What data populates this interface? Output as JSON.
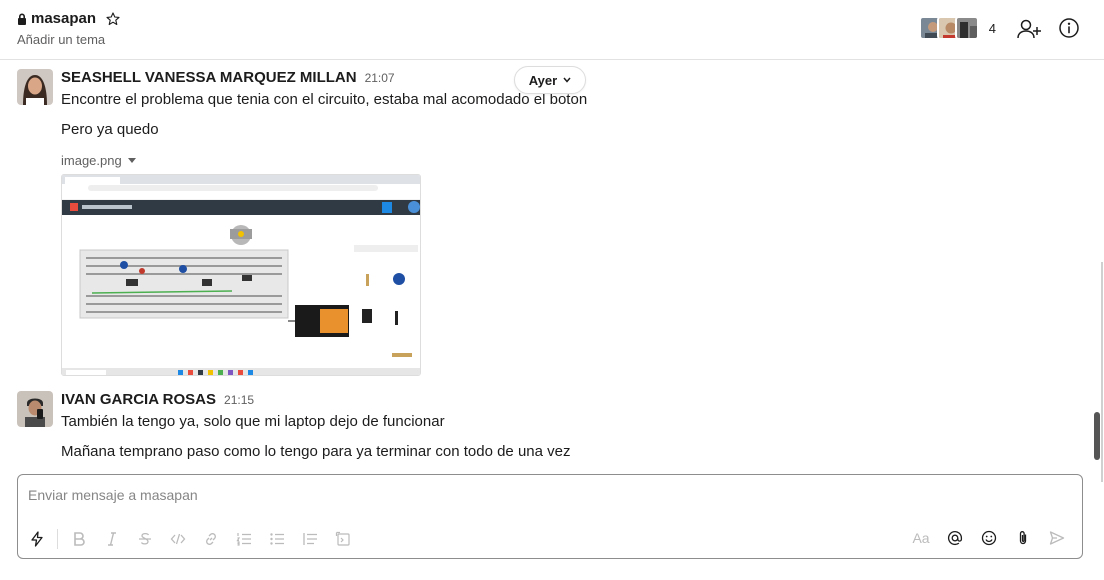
{
  "header": {
    "channel_name": "masapan",
    "topic": "Añadir un tema",
    "member_count": "4"
  },
  "date_pill": {
    "label": "Ayer"
  },
  "messages": [
    {
      "sender": "SEASHELL VANESSA MARQUEZ MILLAN",
      "time": "21:07",
      "lines": [
        "Encontre el problema que tenia con el circuito, estaba mal acomodado el boton",
        "Pero ya quedo"
      ],
      "attachment": {
        "file_name": "image.png"
      }
    },
    {
      "sender": "IVAN GARCIA ROSAS",
      "time": "21:15",
      "lines": [
        "También la tengo ya, solo que mi laptop dejo de funcionar",
        "Mañana temprano paso como lo tengo para ya terminar con todo de una vez"
      ]
    }
  ],
  "composer": {
    "placeholder": "Enviar mensaje a masapan",
    "format_label": "Aa"
  },
  "colors": {
    "text": "#1d1c1d",
    "muted": "#616061",
    "border": "#8d8d8d",
    "tool_icon": "#bbbbbb"
  }
}
